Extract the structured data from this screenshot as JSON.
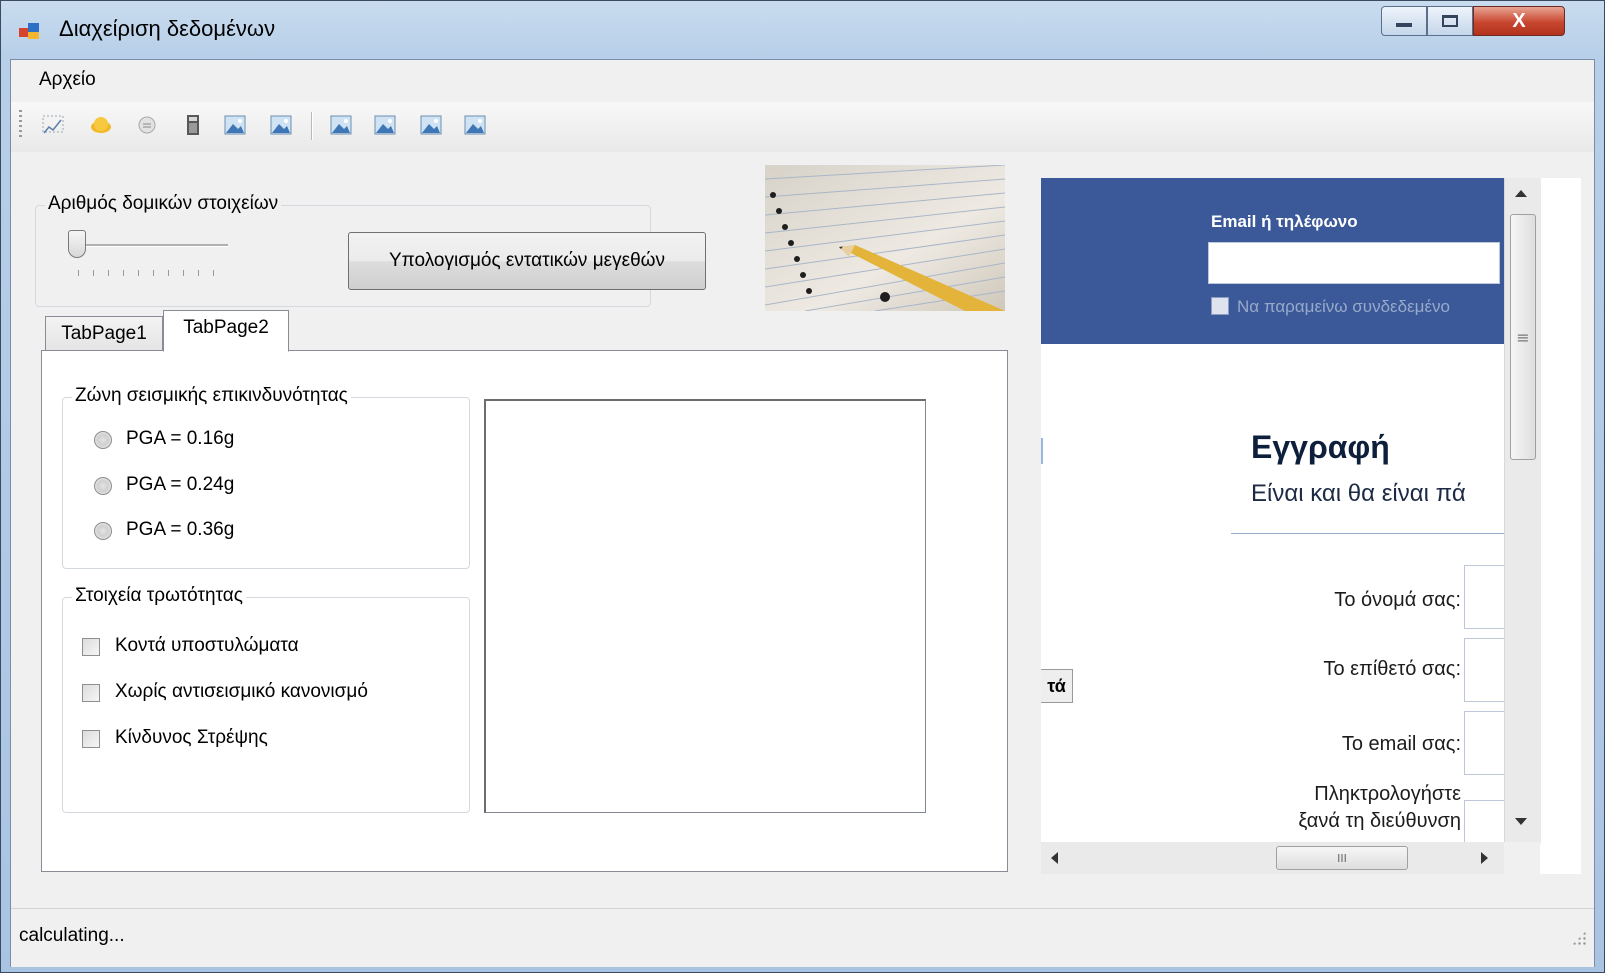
{
  "window": {
    "title": "Διαχείριση δεδομένων",
    "minimize_glyph": "—",
    "maximize_glyph": "□",
    "close_glyph": "X"
  },
  "menu": {
    "file_label": "Αρχείο"
  },
  "toolbar": {
    "icons": [
      "chart-icon",
      "hardhat-icon",
      "disc-icon",
      "calculator-icon",
      "image-icon",
      "image-icon",
      "image-icon",
      "image-icon",
      "image-icon",
      "image-icon"
    ]
  },
  "elements_group": {
    "title": "Αριθμός δομικών στοιχείων",
    "slider_value": 0,
    "calc_button_label": "Υπολογισμός εντατικών μεγεθών"
  },
  "tabs": [
    {
      "label": "TabPage1"
    },
    {
      "label": "TabPage2"
    }
  ],
  "seismic_group": {
    "title": "Ζώνη σεισμικής επικινδυνότητας",
    "options": [
      "PGA = 0.16g",
      "PGA = 0.24g",
      "PGA = 0.36g"
    ]
  },
  "vulnerability_group": {
    "title": "Στοιχεία τρωτότητας",
    "options": [
      "Κοντά υποστυλώματα",
      "Χωρίς αντισεισμικό κανονισμό",
      "Κίνδυνος Στρέψης"
    ]
  },
  "browser": {
    "email_label": "Email ή τηλέφωνο",
    "remember_label": "Να παραμείνω συνδεδεμένο",
    "signup_heading": "Εγγραφή",
    "signup_subtitle": "Είναι και θα είναι πά",
    "first_name_label": "Το όνομά σας:",
    "last_name_label": "Το επίθετό σας:",
    "email_field_label": "Το email σας:",
    "reenter_label_line1": "Πληκτρολογήστε",
    "reenter_label_line2": "ξανά τη διεύθυνση",
    "partial_button_label": "τά",
    "hscroll_grip": "III",
    "vscroll_grip": "≡"
  },
  "status": {
    "text": "calculating..."
  },
  "colors": {
    "facebook_blue": "#3b5998",
    "window_frame": "#b7cfe8"
  }
}
